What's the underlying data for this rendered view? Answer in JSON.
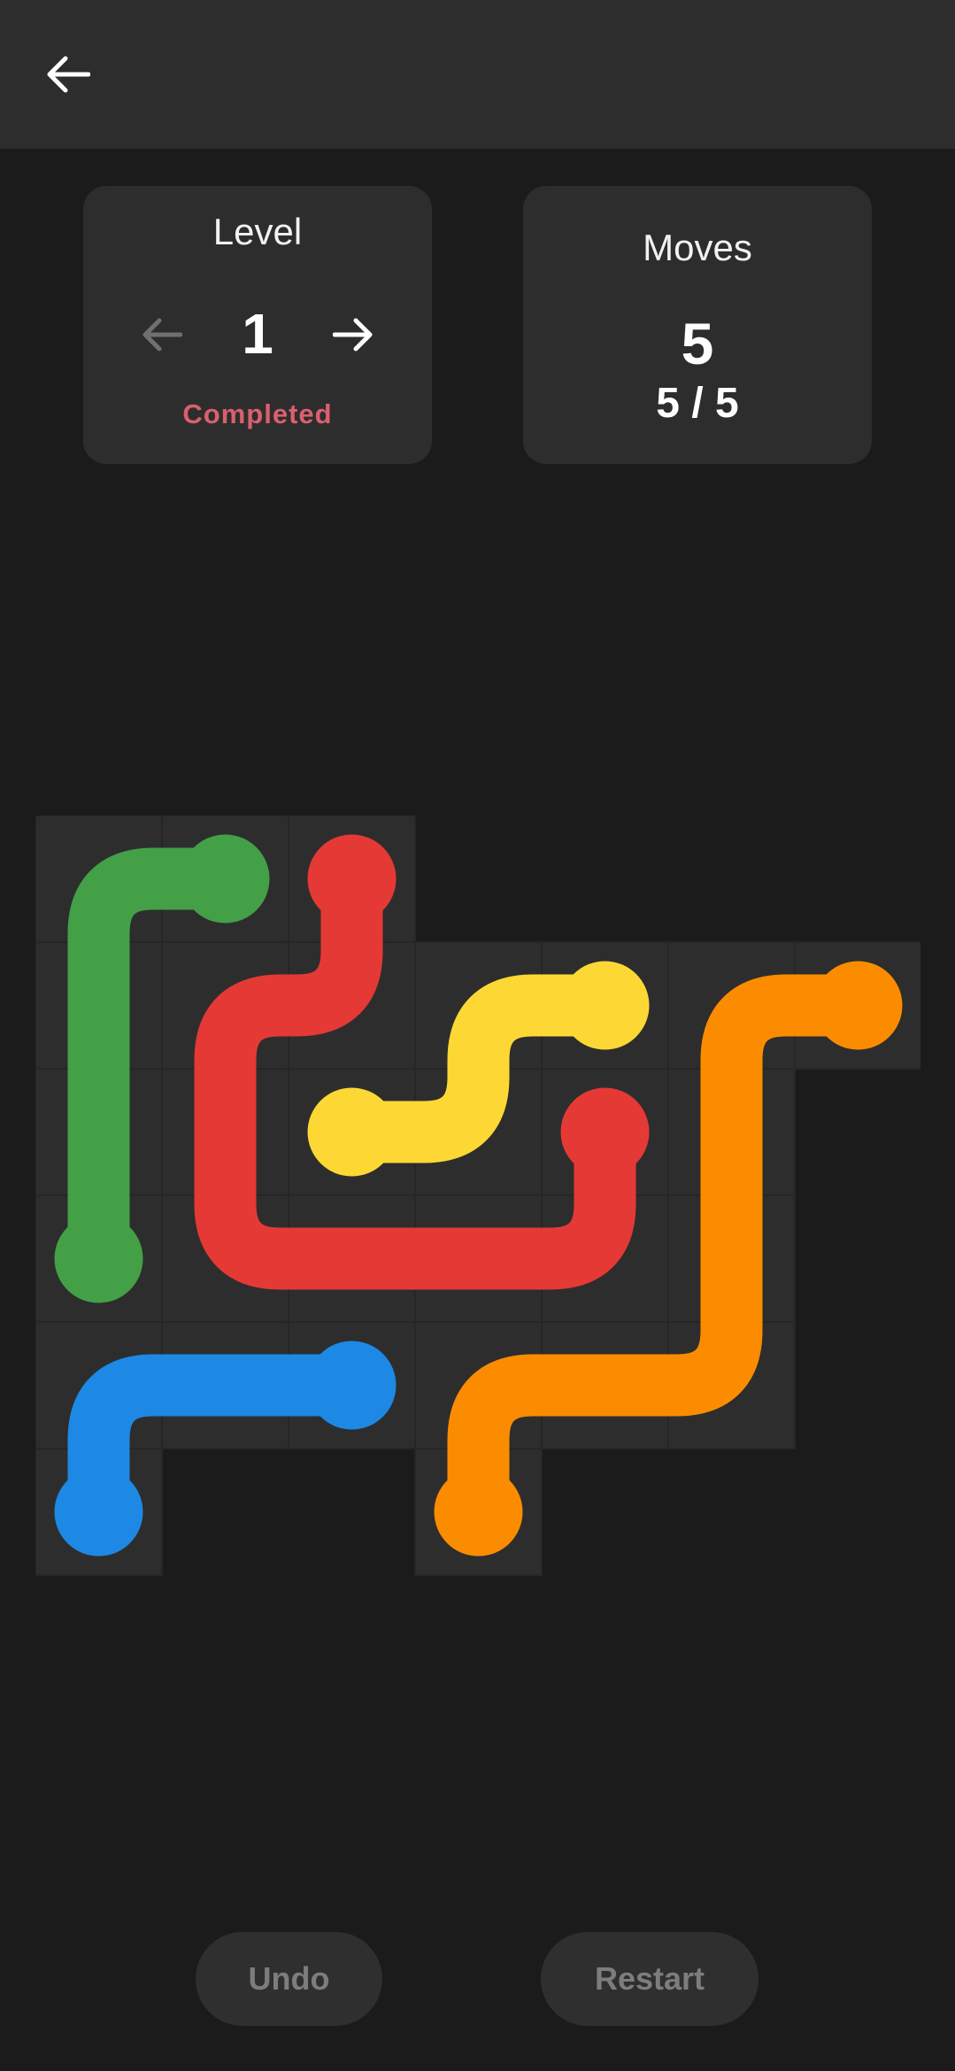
{
  "header": {
    "back_icon": "arrow-left-icon"
  },
  "level_card": {
    "title": "Level",
    "number": "1",
    "status": "Completed",
    "prev_icon": "arrow-left-icon",
    "next_icon": "arrow-right-icon",
    "status_color": "#d9606e"
  },
  "moves_card": {
    "title": "Moves",
    "count": "5",
    "ratio": "5 / 5"
  },
  "board": {
    "rows": 6,
    "cols": 7,
    "active_cells": [
      [
        0,
        0
      ],
      [
        0,
        1
      ],
      [
        0,
        2
      ],
      [
        1,
        0
      ],
      [
        1,
        1
      ],
      [
        1,
        2
      ],
      [
        1,
        3
      ],
      [
        1,
        4
      ],
      [
        1,
        5
      ],
      [
        1,
        6
      ],
      [
        2,
        0
      ],
      [
        2,
        1
      ],
      [
        2,
        2
      ],
      [
        2,
        3
      ],
      [
        2,
        4
      ],
      [
        2,
        5
      ],
      [
        3,
        0
      ],
      [
        3,
        1
      ],
      [
        3,
        2
      ],
      [
        3,
        3
      ],
      [
        3,
        4
      ],
      [
        3,
        5
      ],
      [
        4,
        0
      ],
      [
        4,
        1
      ],
      [
        4,
        2
      ],
      [
        4,
        3
      ],
      [
        4,
        4
      ],
      [
        4,
        5
      ],
      [
        5,
        0
      ],
      [
        5,
        3
      ]
    ],
    "flows": [
      {
        "color": "green",
        "hex": "#43a047",
        "path": [
          [
            0,
            1
          ],
          [
            0,
            0
          ],
          [
            1,
            0
          ],
          [
            2,
            0
          ],
          [
            3,
            0
          ]
        ]
      },
      {
        "color": "red",
        "hex": "#e53935",
        "path": [
          [
            0,
            2
          ],
          [
            1,
            2
          ],
          [
            1,
            1
          ],
          [
            2,
            1
          ],
          [
            3,
            1
          ],
          [
            3,
            2
          ],
          [
            3,
            3
          ],
          [
            3,
            4
          ],
          [
            2,
            4
          ]
        ]
      },
      {
        "color": "yellow",
        "hex": "#fdd835",
        "path": [
          [
            2,
            2
          ],
          [
            2,
            3
          ],
          [
            1,
            3
          ],
          [
            1,
            4
          ]
        ]
      },
      {
        "color": "orange",
        "hex": "#fb8c00",
        "path": [
          [
            1,
            6
          ],
          [
            1,
            5
          ],
          [
            2,
            5
          ],
          [
            3,
            5
          ],
          [
            4,
            5
          ],
          [
            4,
            4
          ],
          [
            4,
            3
          ],
          [
            5,
            3
          ]
        ]
      },
      {
        "color": "blue",
        "hex": "#1e88e5",
        "path": [
          [
            4,
            2
          ],
          [
            4,
            1
          ],
          [
            4,
            0
          ],
          [
            5,
            0
          ]
        ]
      }
    ]
  },
  "actions": {
    "undo_label": "Undo",
    "restart_label": "Restart"
  }
}
